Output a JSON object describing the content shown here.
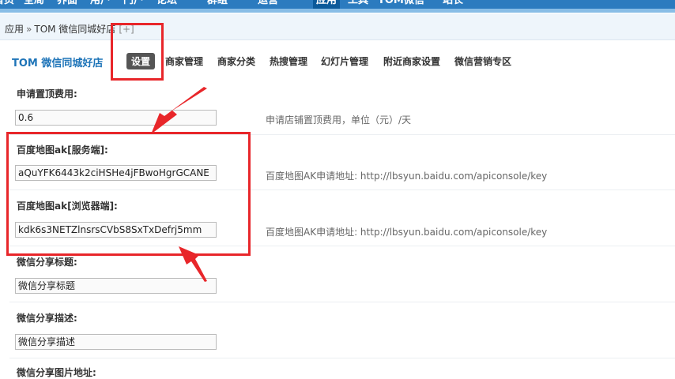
{
  "topnav": {
    "items": [
      {
        "label": "首页"
      },
      {
        "label": "全局"
      },
      {
        "label": "界面"
      },
      {
        "label": "用户"
      },
      {
        "label": "门户"
      },
      {
        "label": "论坛"
      },
      {
        "label": "群组"
      },
      {
        "label": "运营"
      },
      {
        "label": "应用"
      },
      {
        "label": "工具"
      },
      {
        "label": "TOM微信"
      },
      {
        "label": "站长"
      }
    ]
  },
  "breadcrumb": {
    "root": "应用",
    "separator": "»",
    "current": "TOM 微信同城好店",
    "add": "[+]"
  },
  "plugin": {
    "title": "TOM 微信同城好店"
  },
  "tabs": [
    {
      "label": "设置"
    },
    {
      "label": "商家管理"
    },
    {
      "label": "商家分类"
    },
    {
      "label": "热搜管理"
    },
    {
      "label": "幻灯片管理"
    },
    {
      "label": "附近商家设置"
    },
    {
      "label": "微信营销专区"
    }
  ],
  "form": {
    "fields": [
      {
        "label": "申请置顶费用:",
        "value": "0.6",
        "hint": "申请店铺置顶费用，单位（元）/天"
      },
      {
        "label": "百度地图ak[服务端]:",
        "value": "aQuYFK6443k2ciHSHe4jFBwoHgrGCANE",
        "hint": "百度地图AK申请地址:   http://lbsyun.baidu.com/apiconsole/key"
      },
      {
        "label": "百度地图ak[浏览器端]:",
        "value": "kdk6s3NETZlnsrsCVbS8SxTxDefrj5mm",
        "hint": "百度地图AK申请地址:   http://lbsyun.baidu.com/apiconsole/key"
      },
      {
        "label": "微信分享标题:",
        "value": "微信分享标题",
        "hint": ""
      },
      {
        "label": "微信分享描述:",
        "value": "微信分享描述",
        "hint": ""
      },
      {
        "label": "微信分享图片地址:",
        "value": "",
        "hint": ""
      }
    ]
  },
  "colors": {
    "accent": "#1e74b8",
    "nav": "#2b7bbf",
    "annotation": "#e8262a"
  }
}
